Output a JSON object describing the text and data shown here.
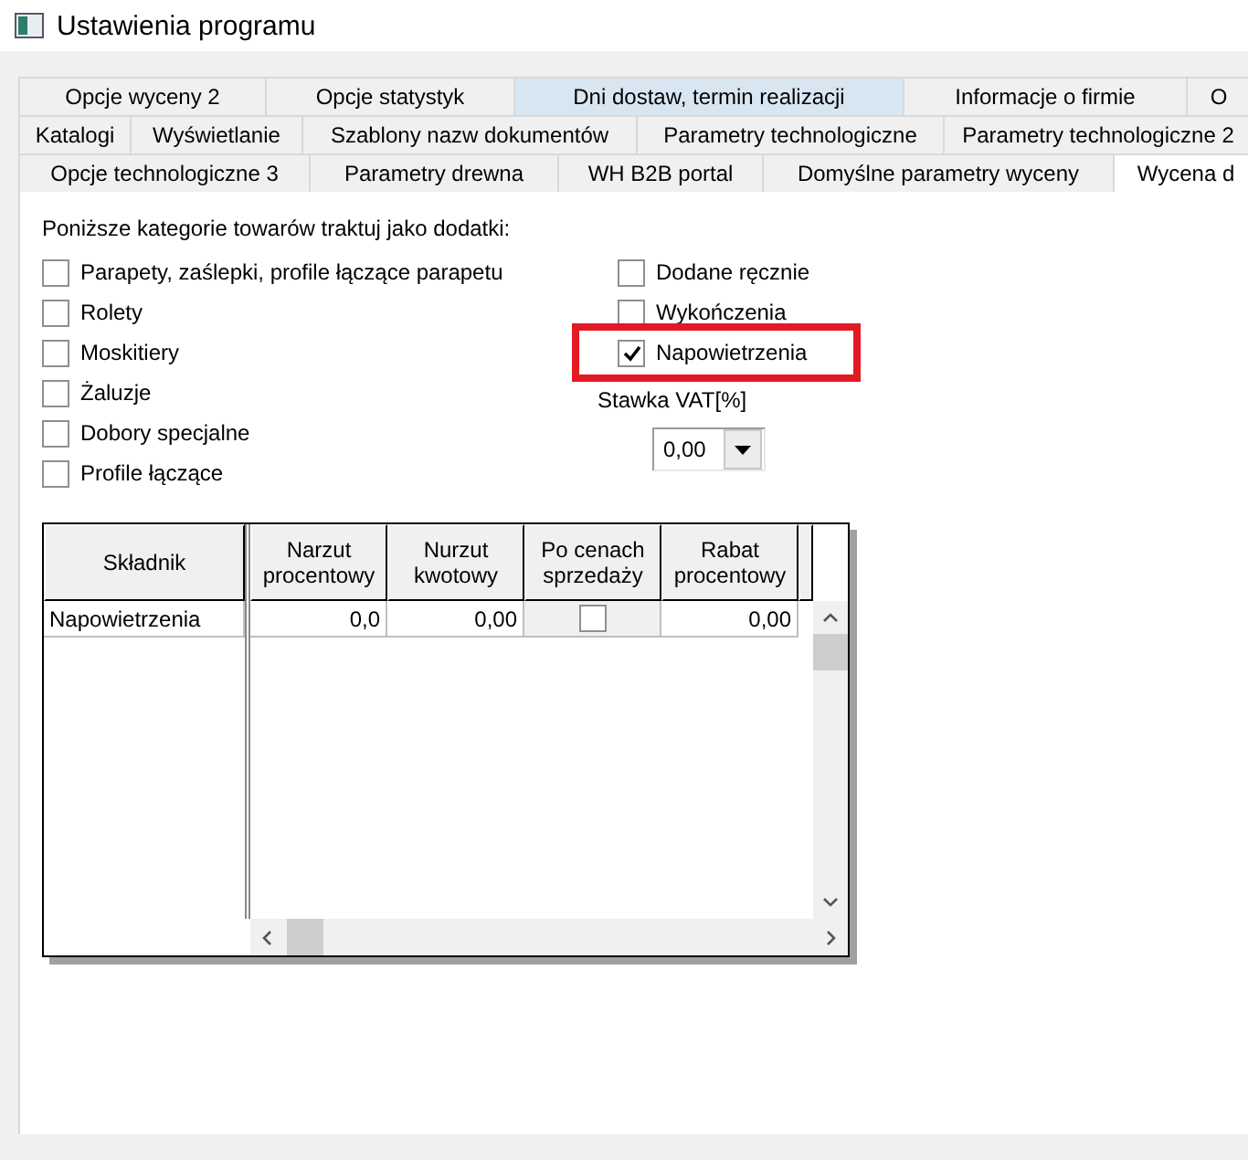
{
  "window": {
    "title": "Ustawienia programu"
  },
  "tab_rows": [
    [
      {
        "label": "Opcje wyceny 2",
        "selected": false,
        "hovered": false
      },
      {
        "label": "Opcje statystyk",
        "selected": false,
        "hovered": false
      },
      {
        "label": "Dni dostaw, termin realizacji",
        "selected": false,
        "hovered": true
      },
      {
        "label": "Informacje o firmie",
        "selected": false,
        "hovered": false
      },
      {
        "label": "O",
        "selected": false,
        "hovered": false
      }
    ],
    [
      {
        "label": "Katalogi",
        "selected": false,
        "hovered": false
      },
      {
        "label": "Wyświetlanie",
        "selected": false,
        "hovered": false
      },
      {
        "label": "Szablony nazw dokumentów",
        "selected": false,
        "hovered": false
      },
      {
        "label": "Parametry technologiczne",
        "selected": false,
        "hovered": false
      },
      {
        "label": "Parametry technologiczne 2",
        "selected": false,
        "hovered": false
      }
    ],
    [
      {
        "label": "Opcje technologiczne 3",
        "selected": false,
        "hovered": false
      },
      {
        "label": "Parametry drewna",
        "selected": false,
        "hovered": false
      },
      {
        "label": "WH B2B portal",
        "selected": false,
        "hovered": false
      },
      {
        "label": "Domyślne parametry wyceny",
        "selected": false,
        "hovered": false
      },
      {
        "label": "Wycena d",
        "selected": true,
        "hovered": false
      }
    ]
  ],
  "section_label": "Poniższe kategorie towarów traktuj jako dodatki:",
  "categories_left": [
    {
      "label": "Parapety, zaślepki, profile łączące parapetu",
      "checked": false,
      "highlighted": false
    },
    {
      "label": "Rolety",
      "checked": false,
      "highlighted": false
    },
    {
      "label": "Moskitiery",
      "checked": false,
      "highlighted": false
    },
    {
      "label": "Żaluzje",
      "checked": false,
      "highlighted": false
    },
    {
      "label": "Dobory specjalne",
      "checked": false,
      "highlighted": false
    },
    {
      "label": "Profile łączące",
      "checked": false,
      "highlighted": false
    }
  ],
  "categories_right": [
    {
      "label": "Dodane ręcznie",
      "checked": false,
      "highlighted": false
    },
    {
      "label": "Wykończenia",
      "checked": false,
      "highlighted": false
    },
    {
      "label": "Napowietrzenia",
      "checked": true,
      "highlighted": true
    }
  ],
  "vat": {
    "label": "Stawka VAT[%]",
    "value": "0,00"
  },
  "grid": {
    "columns": [
      "Składnik",
      "Narzut procentowy",
      "Nurzut kwotowy",
      "Po cenach sprzedaży",
      "Rabat procentowy"
    ],
    "rows": [
      {
        "cells": [
          {
            "kind": "text",
            "value": "Napowietrzenia"
          },
          {
            "kind": "number",
            "value": "0,0"
          },
          {
            "kind": "number",
            "value": "0,00"
          },
          {
            "kind": "checkbox",
            "checked": false
          },
          {
            "kind": "number",
            "value": "0,00"
          }
        ]
      }
    ]
  }
}
